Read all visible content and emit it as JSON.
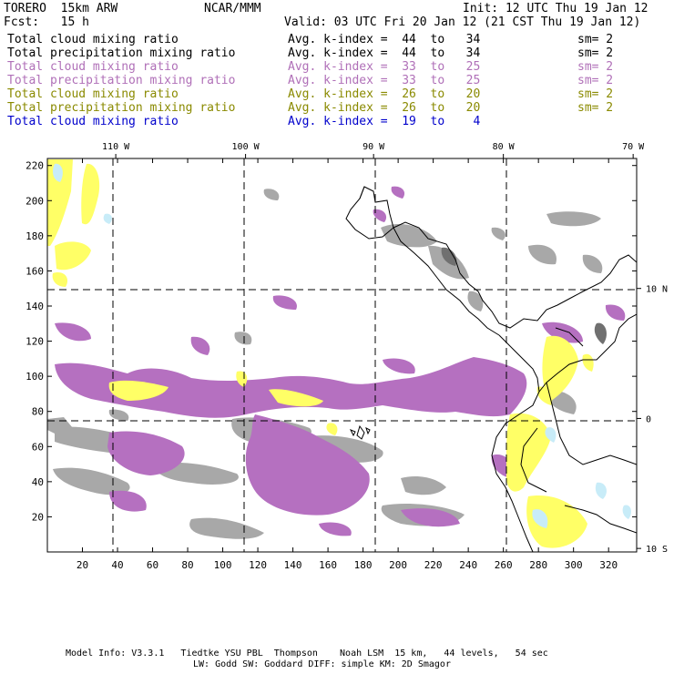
{
  "header": {
    "model": "TORERO  15km ARW",
    "center": "NCAR/MMM",
    "init": "Init: 12 UTC Thu 19 Jan 12",
    "fcst": "Fcst:   15 h",
    "valid": "Valid: 03 UTC Fri 20 Jan 12 (21 CST Thu 19 Jan 12)"
  },
  "legend": [
    {
      "field": "Total cloud mixing ratio",
      "kindex": "Avg. k-index =  44  to   34",
      "sm": "sm= 2",
      "color": "#000000"
    },
    {
      "field": "Total precipitation mixing ratio",
      "kindex": "Avg. k-index =  44  to   34",
      "sm": "sm= 2",
      "color": "#000000"
    },
    {
      "field": "Total cloud mixing ratio",
      "kindex": "Avg. k-index =  33  to   25",
      "sm": "sm= 2",
      "color": "#b070b8"
    },
    {
      "field": "Total precipitation mixing ratio",
      "kindex": "Avg. k-index =  33  to   25",
      "sm": "sm= 2",
      "color": "#b070b8"
    },
    {
      "field": "Total cloud mixing ratio",
      "kindex": "Avg. k-index =  26  to   20",
      "sm": "sm= 2",
      "color": "#8a8a00"
    },
    {
      "field": "Total precipitation mixing ratio",
      "kindex": "Avg. k-index =  26  to   20",
      "sm": "sm= 2",
      "color": "#8a8a00"
    },
    {
      "field": "Total cloud mixing ratio",
      "kindex": "Avg. k-index =  19  to    4",
      "sm": "",
      "color": "#0000cc"
    }
  ],
  "map": {
    "lon_labels": [
      {
        "label": "110 W",
        "i": 39
      },
      {
        "label": "100 W",
        "i": 113
      },
      {
        "label": "90 W",
        "i": 186
      },
      {
        "label": "80 W",
        "i": 260
      },
      {
        "label": "70 W",
        "i": 334
      }
    ],
    "lat_labels": [
      {
        "label": "10 N",
        "j": 150
      },
      {
        "label": "0",
        "j": 76
      },
      {
        "label": "10 S",
        "j": 2
      }
    ],
    "x_ticks": [
      20,
      40,
      60,
      80,
      100,
      120,
      140,
      160,
      180,
      200,
      220,
      240,
      260,
      280,
      300,
      320
    ],
    "y_ticks": [
      20,
      40,
      60,
      80,
      100,
      120,
      140,
      160,
      180,
      200,
      220
    ],
    "colors": {
      "gray": "#a8a8a8",
      "purple": "#b570c0",
      "yellow": "#ffff66",
      "lightblue": "#c8ecf8",
      "darkgray": "#707070"
    }
  },
  "footer": {
    "line1": "Model Info: V3.3.1   Tiedtke YSU PBL  Thompson    Noah LSM  15 km,   44 levels,   54 sec",
    "line2": "LW: Godd SW: Goddard DIFF: simple KM: 2D Smagor"
  }
}
